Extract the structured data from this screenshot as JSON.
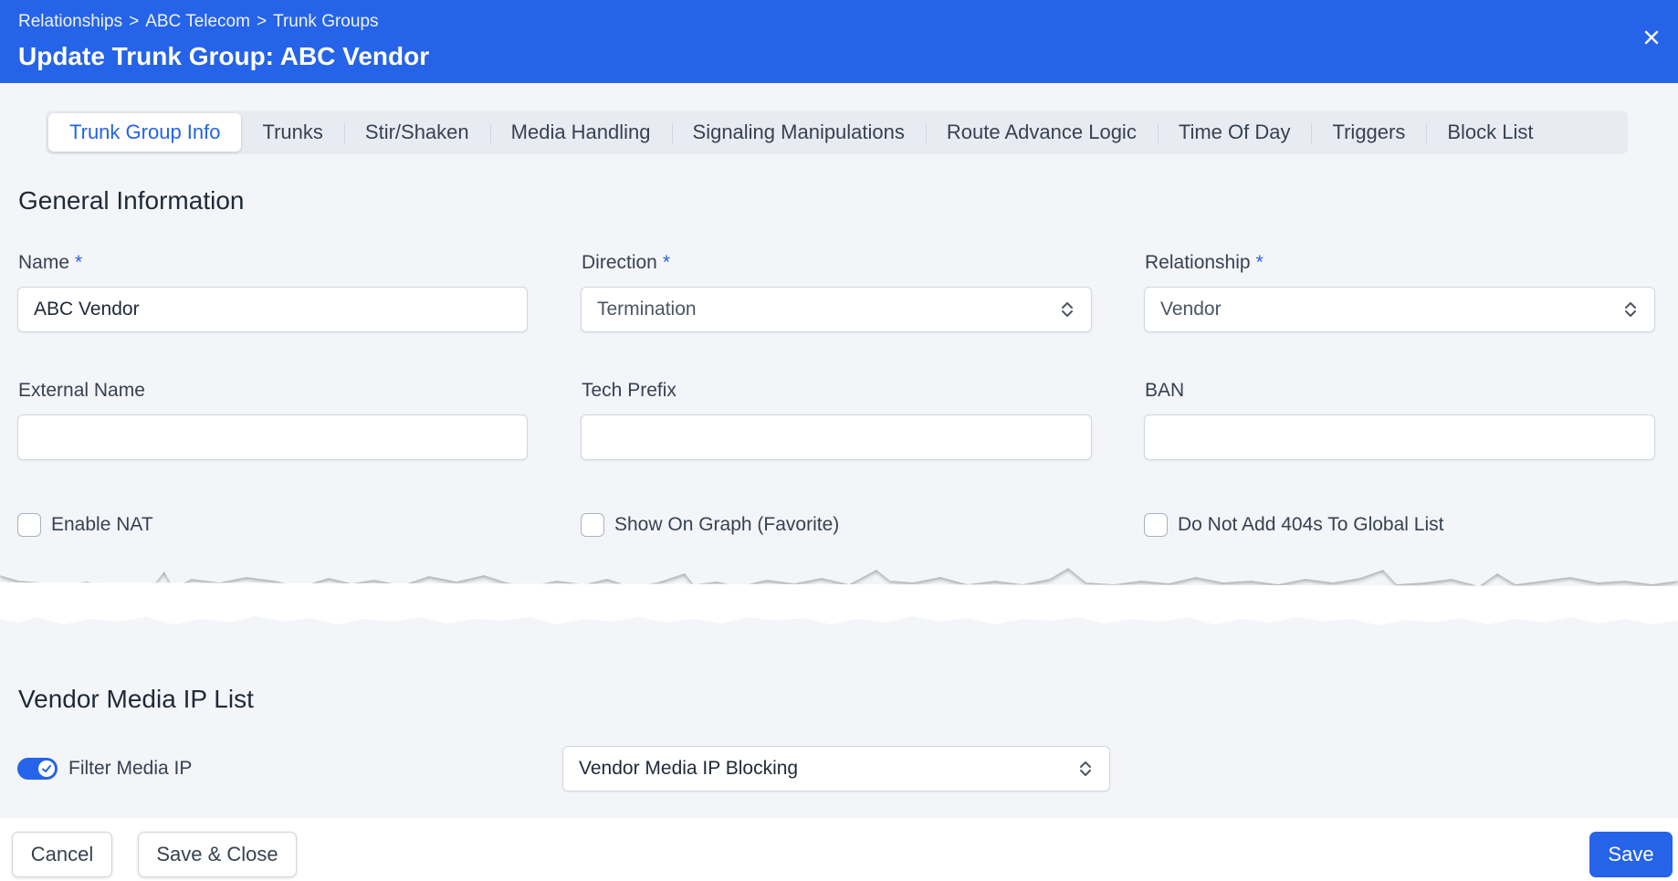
{
  "header": {
    "breadcrumb": [
      "Relationships",
      "ABC Telecom",
      "Trunk Groups"
    ],
    "breadcrumb_sep": ">",
    "title": "Update Trunk Group: ABC Vendor",
    "close_icon": "close-icon"
  },
  "tabs": [
    {
      "label": "Trunk Group Info",
      "active": true
    },
    {
      "label": "Trunks"
    },
    {
      "label": "Stir/Shaken"
    },
    {
      "label": "Media Handling"
    },
    {
      "label": "Signaling Manipulations"
    },
    {
      "label": "Route Advance Logic"
    },
    {
      "label": "Time Of Day"
    },
    {
      "label": "Triggers"
    },
    {
      "label": "Block List"
    }
  ],
  "general": {
    "title": "General Information",
    "name_label": "Name",
    "name_value": "ABC Vendor",
    "direction_label": "Direction",
    "direction_value": "Termination",
    "relationship_label": "Relationship",
    "relationship_value": "Vendor",
    "external_name_label": "External Name",
    "external_name_value": "",
    "tech_prefix_label": "Tech Prefix",
    "tech_prefix_value": "",
    "ban_label": "BAN",
    "ban_value": "",
    "required_marker": "*",
    "enable_nat_label": "Enable NAT",
    "show_on_graph_label": "Show On Graph (Favorite)",
    "no_404_label": "Do Not Add 404s To Global List"
  },
  "media_ip": {
    "title": "Vendor Media IP List",
    "filter_label": "Filter Media IP",
    "filter_enabled": true,
    "list_value": "Vendor Media IP Blocking"
  },
  "footer": {
    "cancel_label": "Cancel",
    "save_close_label": "Save & Close",
    "save_label": "Save"
  },
  "colors": {
    "primary": "#2563e8",
    "background": "#f3f5f9"
  }
}
